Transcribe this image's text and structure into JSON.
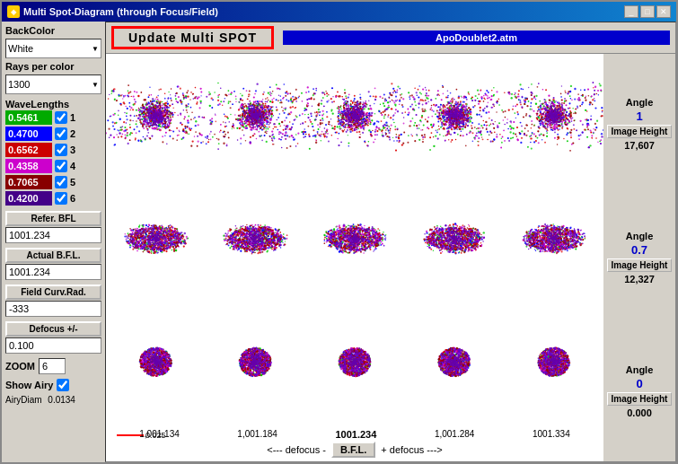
{
  "window": {
    "title": "Multi Spot-Diagram  (through Focus/Field)"
  },
  "left_panel": {
    "backcolor_label": "BackColor",
    "backcolor_value": "White",
    "rays_label": "Rays per color",
    "rays_value": "1300",
    "wavelengths_label": "WaveLengths",
    "wavelengths": [
      {
        "value": "0.5461",
        "color": "#00aa00",
        "checked": true,
        "num": "1"
      },
      {
        "value": "0.4700",
        "color": "#0000ff",
        "checked": true,
        "num": "2"
      },
      {
        "value": "0.6562",
        "color": "#cc0000",
        "checked": true,
        "num": "3"
      },
      {
        "value": "0.4358",
        "color": "#cc00cc",
        "checked": true,
        "num": "4"
      },
      {
        "value": "0.7065",
        "color": "#880000",
        "checked": true,
        "num": "5"
      },
      {
        "value": "0.4200",
        "color": "#440088",
        "checked": true,
        "num": "6"
      }
    ],
    "refer_bfl_label": "Refer. BFL",
    "refer_bfl_value": "1001.234",
    "actual_bfl_label": "Actual B.F.L.",
    "actual_bfl_value": "1001.234",
    "field_curv_label": "Field Curv.Rad.",
    "field_curv_value": "-333",
    "defocus_label": "Defocus +/-",
    "defocus_value": "0.100",
    "zoom_label": "ZOOM",
    "zoom_value": "6",
    "show_airy_label": "Show Airy",
    "airy_diam_label": "AiryDiam",
    "airy_diam_value": "0.0134"
  },
  "toolbar": {
    "update_btn_label": "Update  Multi SPOT",
    "filename": "ApoDoublet2.atm"
  },
  "axis": {
    "scale_value": "0.025",
    "positions": [
      "1,001.134",
      "1,001.184",
      "1001.234",
      "1,001.284",
      "1001.334"
    ],
    "defocus_left": "<---  defocus -",
    "bfl_label": "B.F.L.",
    "defocus_right": "+ defocus --->"
  },
  "right_panel": {
    "angles": [
      {
        "angle_label": "Angle",
        "angle_value": "1",
        "img_height_label": "Image Height",
        "img_height_value": "17,607"
      },
      {
        "angle_label": "Angle",
        "angle_value": "0.7",
        "img_height_label": "Image Height",
        "img_height_value": "12,327"
      },
      {
        "angle_label": "Angle",
        "angle_value": "0",
        "img_height_label": "Image Height",
        "img_height_value": "0.000"
      }
    ]
  }
}
